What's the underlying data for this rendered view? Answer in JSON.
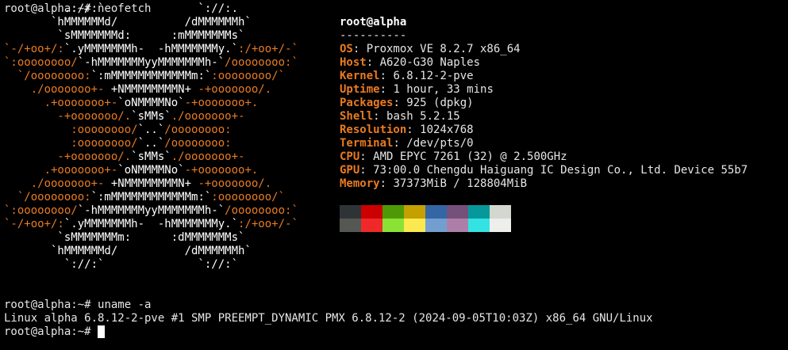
{
  "terminal": {
    "prompt": "root@alpha:~#",
    "cmd1": "neofetch",
    "cmd2": "uname -a",
    "uname_output": "Linux alpha 6.8.12-2-pve #1 SMP PREEMPT_DYNAMIC PMX 6.8.12-2 (2024-09-05T10:03Z) x86_64 GNU/Linux"
  },
  "neofetch": {
    "title": "root@alpha",
    "separator": "----------",
    "fields": [
      {
        "key": "OS",
        "value": "Proxmox VE 8.2.7 x86_64"
      },
      {
        "key": "Host",
        "value": "A620-G30 Naples"
      },
      {
        "key": "Kernel",
        "value": "6.8.12-2-pve"
      },
      {
        "key": "Uptime",
        "value": "1 hour, 33 mins"
      },
      {
        "key": "Packages",
        "value": "925 (dpkg)"
      },
      {
        "key": "Shell",
        "value": "bash 5.2.15"
      },
      {
        "key": "Resolution",
        "value": "1024x768"
      },
      {
        "key": "Terminal",
        "value": "/dev/pts/0"
      },
      {
        "key": "CPU",
        "value": "AMD EPYC 7261 (32) @ 2.500GHz"
      },
      {
        "key": "GPU",
        "value": "73:00.0 Chengdu Haiguang IC Design Co., Ltd. Device 55b7"
      },
      {
        "key": "Memory",
        "value": "37373MiB / 128804MiB"
      }
    ],
    "logo": [
      [
        [
          "w",
          "         .://:`              `://:."
        ]
      ],
      [
        [
          "w",
          "       `hMMMMMMd/          /dMMMMMMh`"
        ]
      ],
      [
        [
          "w",
          "        `sMMMMMMMd:      :mMMMMMMMs`"
        ]
      ],
      [
        [
          "o",
          "`-/+oo+/:"
        ],
        [
          "w",
          "`.yMMMMMMMh-  -hMMMMMMMy.`"
        ],
        [
          "o",
          ":/+oo+/-`"
        ]
      ],
      [
        [
          "o",
          "`:oooooooo/"
        ],
        [
          "w",
          "`-hMMMMMMMyyMMMMMMMh-`"
        ],
        [
          "o",
          "/oooooooo:`"
        ]
      ],
      [
        [
          "o",
          "  `/oooooooo:"
        ],
        [
          "w",
          "`:mMMMMMMMMMMMMm:`"
        ],
        [
          "o",
          ":oooooooo/`"
        ]
      ],
      [
        [
          "o",
          "    ./ooooooo+- "
        ],
        [
          "w",
          "+NMMMMMMMMN+ "
        ],
        [
          "o",
          "-+ooooooo/."
        ]
      ],
      [
        [
          "o",
          "      .+ooooooo+-"
        ],
        [
          "w",
          "`oNMMMMNo`"
        ],
        [
          "o",
          "-+ooooooo+."
        ]
      ],
      [
        [
          "o",
          "        -+ooooooo/."
        ],
        [
          "w",
          "`sMMs`"
        ],
        [
          "o",
          "./ooooooo+-"
        ]
      ],
      [
        [
          "o",
          "          :oooooooo/"
        ],
        [
          "w",
          "`..`"
        ],
        [
          "o",
          "/oooooooo:"
        ]
      ],
      [
        [
          "o",
          "          :oooooooo/"
        ],
        [
          "w",
          "`..`"
        ],
        [
          "o",
          "/oooooooo:"
        ]
      ],
      [
        [
          "o",
          "        -+ooooooo/."
        ],
        [
          "w",
          "`sMMs`"
        ],
        [
          "o",
          "./ooooooo+-"
        ]
      ],
      [
        [
          "o",
          "      .+ooooooo+-"
        ],
        [
          "w",
          "`oNMMMMNo`"
        ],
        [
          "o",
          "-+ooooooo+."
        ]
      ],
      [
        [
          "o",
          "    ./ooooooo+- "
        ],
        [
          "w",
          "+NMMMMMMMMN+ "
        ],
        [
          "o",
          "-+ooooooo/."
        ]
      ],
      [
        [
          "o",
          "  `/oooooooo:"
        ],
        [
          "w",
          "`:mMMMMMMMMMMMMm:`"
        ],
        [
          "o",
          ":oooooooo/`"
        ]
      ],
      [
        [
          "o",
          "`:oooooooo/"
        ],
        [
          "w",
          "`-hMMMMMMMyyMMMMMMMh-`"
        ],
        [
          "o",
          "/oooooooo:`"
        ]
      ],
      [
        [
          "o",
          "`-/+oo+/:"
        ],
        [
          "w",
          "`.yMMMMMMMh-  -hMMMMMMMy.`"
        ],
        [
          "o",
          ":/+oo+/-`"
        ]
      ],
      [
        [
          "w",
          "        `sMMMMMMMm:      :dMMMMMMMs`"
        ]
      ],
      [
        [
          "w",
          "       `hMMMMMMd/          /dMMMMMMh`"
        ]
      ],
      [
        [
          "w",
          "         `://:`              `://:`"
        ]
      ]
    ],
    "palette": {
      "normal": [
        "#2e3436",
        "#cc0000",
        "#4e9a06",
        "#c4a000",
        "#3465a4",
        "#75507b",
        "#06989a",
        "#d3d7cf"
      ],
      "bright": [
        "#555753",
        "#ef2929",
        "#8ae234",
        "#fce94f",
        "#729fcf",
        "#ad7fa8",
        "#34e2e2",
        "#eeeeec"
      ]
    }
  },
  "colors": {
    "background": "#000000",
    "accent": "#e97b21",
    "foreground": "#e6e6e6"
  }
}
